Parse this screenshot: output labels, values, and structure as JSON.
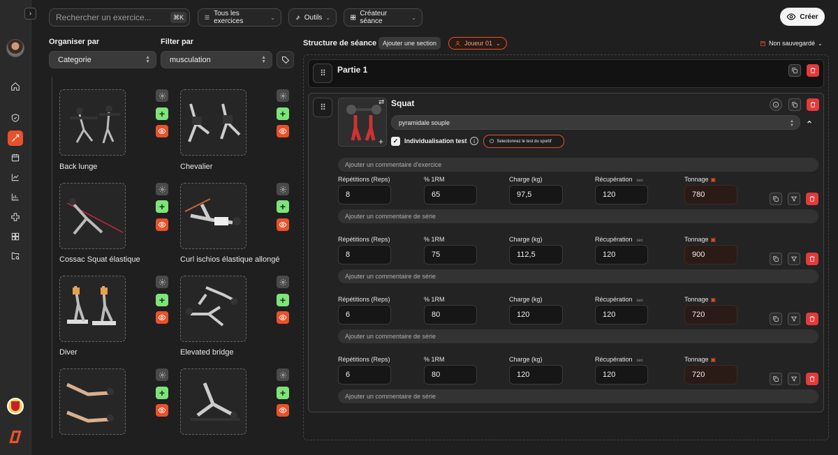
{
  "topbar": {
    "search_placeholder": "Rechercher un exercice...",
    "search_shortcut": "⌘K",
    "filter_all": "Tous les exercices",
    "tools": "Outils",
    "session_creator": "Créateur séance",
    "create": "Créer"
  },
  "library": {
    "organize_label": "Organiser par",
    "organize_value": "Categorie",
    "filter_label": "Filter par",
    "filter_value": "musculation",
    "exercises": [
      {
        "name": "Back lunge"
      },
      {
        "name": "Chevalier"
      },
      {
        "name": "Cossac Squat élastique"
      },
      {
        "name": "Curl ischios élastique allongé"
      },
      {
        "name": "Diver"
      },
      {
        "name": "Elevated bridge"
      },
      {
        "name": ""
      },
      {
        "name": ""
      }
    ]
  },
  "session": {
    "title": "Structure de séance",
    "add_section": "Ajouter une section",
    "player": "Joueur 01",
    "save_status": "Non sauvegardé",
    "part_title": "Partie 1",
    "exercise": {
      "name": "Squat",
      "method": "pyramidale souple",
      "individualisation_label": "Individualisation test",
      "select_test": "Selectionnez le test du sportif",
      "exercise_comment_placeholder": "Ajouter un commentaire d'exercice",
      "labels": {
        "reps": "Répétitions (Reps)",
        "rm": "% 1RM",
        "charge": "Charge (kg)",
        "recup": "Récupération",
        "recup_unit": "sec",
        "tonnage": "Tonnage"
      },
      "series_comment_placeholder": "Ajouter un commentaire de série",
      "sets": [
        {
          "reps": "8",
          "rm": "65",
          "charge": "97,5",
          "recup": "120",
          "tonnage": "780"
        },
        {
          "reps": "8",
          "rm": "75",
          "charge": "112,5",
          "recup": "120",
          "tonnage": "900"
        },
        {
          "reps": "6",
          "rm": "80",
          "charge": "120",
          "recup": "120",
          "tonnage": "720"
        },
        {
          "reps": "6",
          "rm": "80",
          "charge": "120",
          "recup": "120",
          "tonnage": "720"
        }
      ]
    }
  },
  "colors": {
    "accent": "#e8522a",
    "add": "#7ee37a",
    "delete": "#e23b3b"
  }
}
